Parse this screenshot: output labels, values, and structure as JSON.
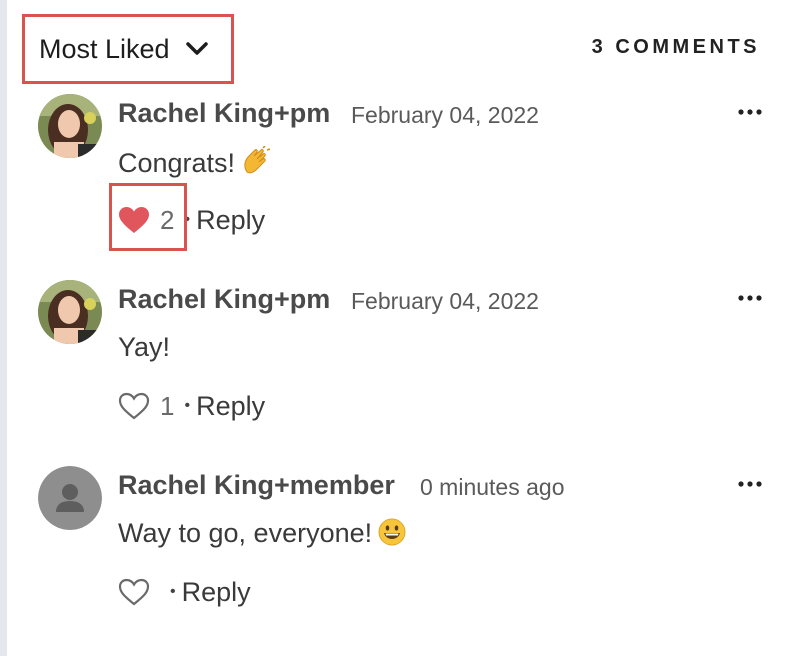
{
  "sort": {
    "label": "Most Liked"
  },
  "header": {
    "comment_count": "3 COMMENTS"
  },
  "comments": [
    {
      "author": "Rachel King+pm",
      "time": "February 04, 2022",
      "body": "Congrats!",
      "emoji": "clapping-hands",
      "likes": "2",
      "liked": true,
      "reply": "Reply"
    },
    {
      "author": "Rachel King+pm",
      "time": "February 04, 2022",
      "body": "Yay!",
      "likes": "1",
      "liked": false,
      "reply": "Reply"
    },
    {
      "author": "Rachel King+member",
      "time": "0 minutes ago",
      "body": "Way to go, everyone!",
      "emoji": "grinning-face",
      "likes": "",
      "liked": false,
      "reply": "Reply"
    }
  ],
  "colors": {
    "highlight": "#d9534f",
    "heart_filled": "#e0565c",
    "text": "#3a3a3a"
  }
}
